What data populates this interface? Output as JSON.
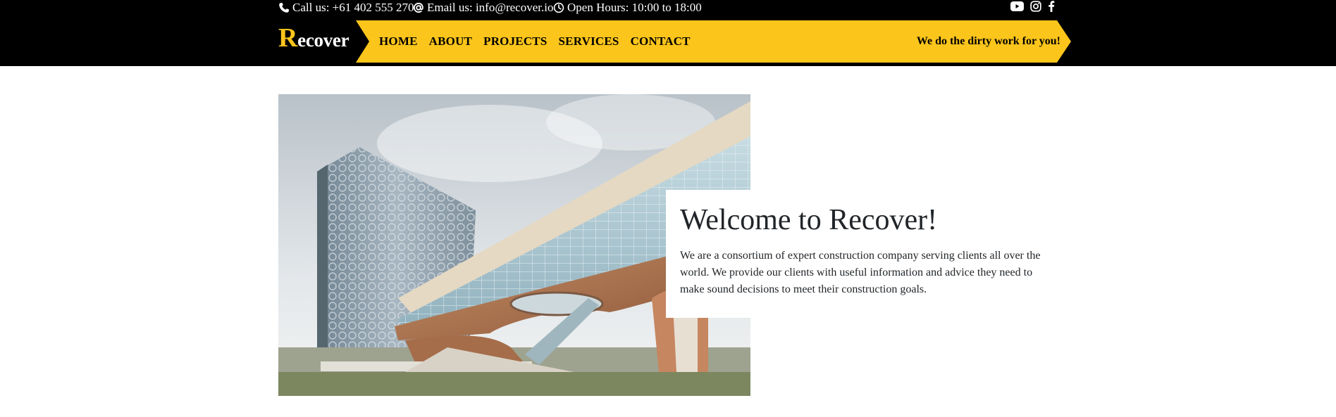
{
  "topbar": {
    "phone": {
      "icon": "phone-icon",
      "text": "Call us: +61 402 555 270"
    },
    "email": {
      "icon": "at-icon",
      "text": "Email us: info@recover.io"
    },
    "hours": {
      "icon": "clock-icon",
      "text": "Open Hours: 10:00 to 18:00"
    },
    "social": [
      {
        "icon": "youtube-icon"
      },
      {
        "icon": "instagram-icon"
      },
      {
        "icon": "facebook-icon"
      }
    ]
  },
  "brand": {
    "first_letter": "R",
    "rest": "ecover"
  },
  "nav": {
    "items": [
      "HOME",
      "ABOUT",
      "PROJECTS",
      "SERVICES",
      "CONTACT"
    ],
    "tagline": "We do the dirty work for you!"
  },
  "hero": {
    "title": "Welcome to Recover!",
    "text": "We are a consortium of expert construction company serving clients all over the world. We provide our clients with useful information and advice they need to make sound decisions to meet their construction goals."
  },
  "colors": {
    "accent": "#fcc51b",
    "header_bg": "#000000",
    "text": "#212529",
    "background": "#ffffff"
  }
}
